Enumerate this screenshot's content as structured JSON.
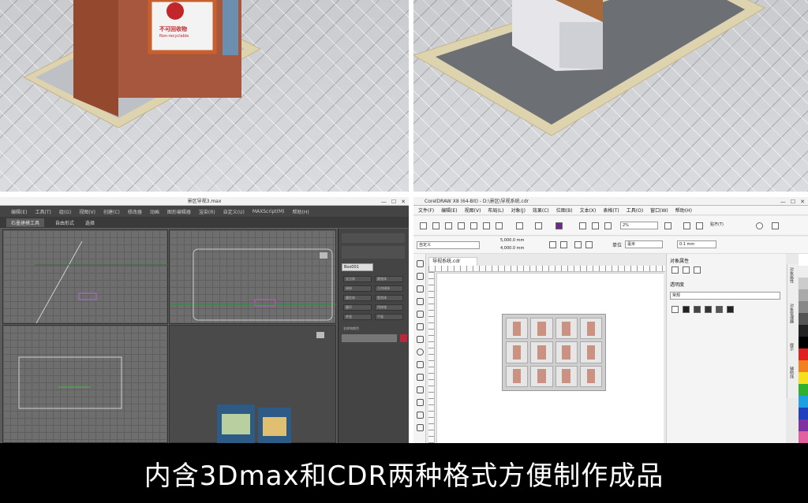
{
  "scene_left": {
    "sign_text_1": "不可回收物",
    "sign_text_2": "Non-recyclable"
  },
  "max_window": {
    "title": "景区导视3.max",
    "menu": [
      "编辑(E)",
      "工具(T)",
      "组(G)",
      "视图(V)",
      "创建(C)",
      "修改器",
      "动画",
      "图形编辑器",
      "渲染(R)",
      "自定义(U)",
      "MAXScript(M)",
      "帮助(H)"
    ],
    "ribbon": [
      "石墨建模工具",
      "自由形式",
      "选择"
    ],
    "active_ribbon": "石墨建模工具",
    "panel_field": "Box001",
    "panel_buttons": [
      "长方体",
      "圆锥体",
      "球体",
      "几何球体",
      "圆柱体",
      "管状体",
      "圆环",
      "四棱锥",
      "茶壶",
      "平面"
    ],
    "panel_label": "名称和颜色"
  },
  "cdr_window": {
    "title": "CorelDRAW X8 (64-Bit) - D:\\景区\\导视系统.cdr",
    "menu": [
      "文件(F)",
      "编辑(E)",
      "视图(V)",
      "布局(L)",
      "对象(J)",
      "效果(C)",
      "位图(B)",
      "文本(X)",
      "表格(T)",
      "工具(O)",
      "窗口(W)",
      "帮助(H)"
    ],
    "zoom": "2%",
    "snap": "贴齐(T)",
    "preset": "自定义",
    "width": "5,000.0 mm",
    "height": "4,000.0 mm",
    "unit_label": "单位",
    "unit": "毫米",
    "nudge": "0.1 mm",
    "doc_tab": "导视系统.cdr",
    "panel_title": "对象属性",
    "transparency_label": "透明度",
    "transparency_mode": "常规",
    "side_tabs": [
      "对象属性",
      "对象管理器",
      "提示",
      "辅助线"
    ]
  },
  "banner": {
    "text": "内含3Dmax和CDR两种格式方便制作成品"
  },
  "colors": {
    "brick": "#a8573f",
    "frame": "#c8602e",
    "dark_ui": "#444444",
    "banner": "#000000"
  }
}
